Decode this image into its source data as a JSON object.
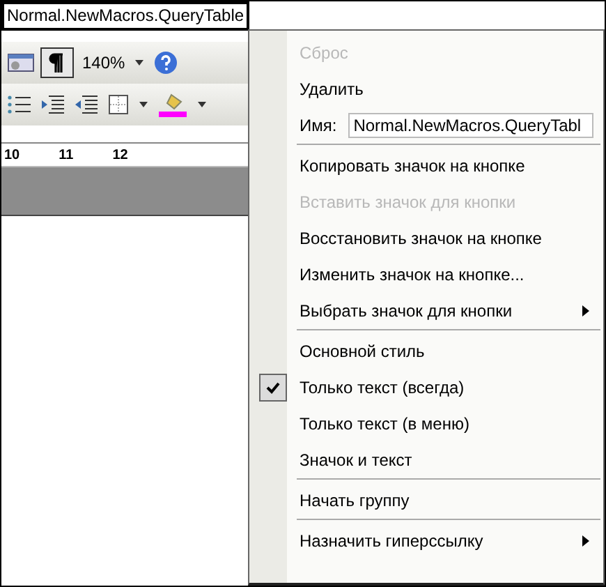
{
  "tooltip": "Normal.NewMacros.QueryTable",
  "toolbar": {
    "zoom": "140%",
    "ruler": [
      "10",
      "11",
      "12"
    ]
  },
  "menu": {
    "items": [
      {
        "kind": "command",
        "label": "Сброс",
        "disabled": true,
        "checked": false,
        "group_start": false
      },
      {
        "kind": "command",
        "label": "Удалить",
        "disabled": false,
        "checked": false,
        "group_start": false
      },
      {
        "kind": "field",
        "label": "Имя:",
        "value": "Normal.NewMacros.QueryTabl",
        "disabled": false,
        "checked": false,
        "group_start": false
      },
      {
        "kind": "command",
        "label": "Копировать значок на кнопке",
        "disabled": false,
        "checked": false,
        "group_start": true
      },
      {
        "kind": "command",
        "label": "Вставить значок для кнопки",
        "disabled": true,
        "checked": false,
        "group_start": false
      },
      {
        "kind": "command",
        "label": "Восстановить значок на кнопке",
        "disabled": false,
        "checked": false,
        "group_start": false
      },
      {
        "kind": "command",
        "label": "Изменить значок на кнопке...",
        "disabled": false,
        "checked": false,
        "group_start": false
      },
      {
        "kind": "submenu",
        "label": "Выбрать значок для кнопки",
        "disabled": false,
        "checked": false,
        "group_start": false
      },
      {
        "kind": "command",
        "label": "Основной стиль",
        "disabled": false,
        "checked": false,
        "group_start": true
      },
      {
        "kind": "command",
        "label": "Только текст (всегда)",
        "disabled": false,
        "checked": true,
        "group_start": false
      },
      {
        "kind": "command",
        "label": "Только текст (в меню)",
        "disabled": false,
        "checked": false,
        "group_start": false
      },
      {
        "kind": "command",
        "label": "Значок и текст",
        "disabled": false,
        "checked": false,
        "group_start": false
      },
      {
        "kind": "command",
        "label": "Начать группу",
        "disabled": false,
        "checked": false,
        "group_start": true
      },
      {
        "kind": "submenu",
        "label": "Назначить гиперссылку",
        "disabled": false,
        "checked": false,
        "group_start": true
      }
    ]
  }
}
